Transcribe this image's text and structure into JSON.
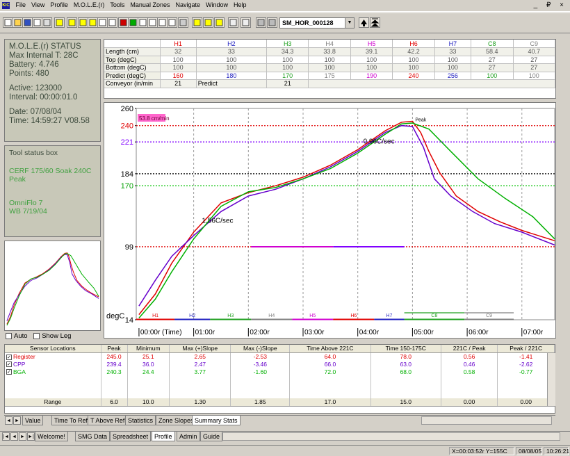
{
  "menu": {
    "items": [
      "File",
      "View",
      "Profile",
      "M.O.L.E.(r)",
      "Tools",
      "Manual Zones",
      "Navigate",
      "Window",
      "Help"
    ],
    "logo": "KIC",
    "window_controls": "_ ₽ ×"
  },
  "toolbar": {
    "icons": [
      "new-icon",
      "open-icon",
      "save-icon",
      "print-preview-icon",
      "print-icon",
      "help-icon",
      "zoom-icon",
      "measure-icon",
      "slope-icon",
      "area-icon",
      "sigma-icon",
      "pen-red-icon",
      "pen-green-icon",
      "curve-icon",
      "lasso-icon",
      "eye-icon",
      "magnify-icon",
      "eraser-icon",
      "face-1-icon",
      "face-2-icon",
      "face-3-icon",
      "calculator-icon",
      "grid-icon",
      "down-arrow-icon",
      "down-arrow-2-icon"
    ],
    "file_selected": "SM_HOR_000128"
  },
  "status": {
    "title": "M.O.L.E.(r) STATUS",
    "internal": "Max Internal T: 28C",
    "battery": "Battery: 4.746",
    "points": "Points: 480",
    "active": "Active: 123000",
    "interval": "Interval: 00:00:01.0",
    "date": "Date: 07/08/04",
    "time": "Time: 14:59:27  V08.58"
  },
  "toolbox": {
    "title": "Tool status box",
    "recipe": "CERF 175/60 Soak 240C Peak",
    "oven": "OmniFlo 7",
    "wb": "WB 7/19/04"
  },
  "legend_toggles": {
    "auto": "Auto",
    "show_leg": "Show Leg"
  },
  "zones": {
    "headers": [
      "H1",
      "H2",
      "H3",
      "H4",
      "H5",
      "H6",
      "H7",
      "C8",
      "C9"
    ],
    "header_colors": [
      "#e00000",
      "#2020c0",
      "#20a020",
      "#808080",
      "#d000d0",
      "#e00000",
      "#2020c0",
      "#20a020",
      "#808080"
    ],
    "rows": [
      {
        "label": "Length (cm)",
        "values": [
          "32",
          "33",
          "34.3",
          "33.8",
          "39.1",
          "42.2",
          "33",
          "58.4",
          "40.7"
        ]
      },
      {
        "label": "Top (degC)",
        "values": [
          "100",
          "100",
          "100",
          "100",
          "100",
          "100",
          "100",
          "27",
          "27"
        ]
      },
      {
        "label": "Bottom (degC)",
        "values": [
          "100",
          "100",
          "100",
          "100",
          "100",
          "100",
          "100",
          "27",
          "27"
        ]
      },
      {
        "label": "Predict (degC)",
        "values": [
          "160",
          "180",
          "170",
          "175",
          "190",
          "240",
          "256",
          "100",
          "100"
        ]
      }
    ],
    "conveyor_label": "Conveyor (in/min",
    "conveyor_value": "21",
    "predict_label": "Predict",
    "predict_value": "21"
  },
  "chart": {
    "speed_badge": "53.8 cm/min",
    "ylabel": "degC",
    "peak_label": "Peak",
    "slope_up": "1.56C/sec",
    "slope_peak": "0.96C/sec",
    "xlabel_first": "00:00r (Time)",
    "zone_labels": [
      "H1",
      "H2",
      "H3",
      "H4",
      "H5",
      "H6",
      "H7",
      "C8",
      "C9"
    ]
  },
  "chart_data": {
    "type": "line",
    "x_unit": "min",
    "x_ticks": [
      {
        "x": 0,
        "label": "00:00r (Time)"
      },
      {
        "x": 1,
        "label": "01:00r"
      },
      {
        "x": 2,
        "label": "02:00r"
      },
      {
        "x": 3,
        "label": "03:00r"
      },
      {
        "x": 4,
        "label": "04:00r"
      },
      {
        "x": 5,
        "label": "05:00r"
      },
      {
        "x": 6,
        "label": "06:00r"
      },
      {
        "x": 7,
        "label": "07:00r"
      }
    ],
    "y_ticks": [
      14,
      99,
      170,
      184,
      221,
      240,
      260
    ],
    "xlim": [
      -0.05,
      7.6
    ],
    "ylim": [
      14,
      260
    ],
    "ref_lines": [
      {
        "y": 240,
        "color": "#e00000",
        "style": "dotted"
      },
      {
        "y": 221,
        "color": "#8000ff",
        "style": "dotted"
      },
      {
        "y": 184,
        "color": "#000000",
        "style": "dotted"
      },
      {
        "y": 170,
        "color": "#00c000",
        "style": "dotted"
      },
      {
        "y": 99,
        "color": "#e00000",
        "style": "dotted"
      }
    ],
    "y_tick_colors": {
      "14": "#000",
      "99": "#000",
      "170": "#00a000",
      "184": "#000",
      "221": "#8000ff",
      "240": "#e00000",
      "260": "#000"
    },
    "series": [
      {
        "name": "Register",
        "color": "#e00000",
        "points": [
          [
            0,
            20
          ],
          [
            0.3,
            44
          ],
          [
            0.6,
            80
          ],
          [
            1,
            116
          ],
          [
            1.5,
            150
          ],
          [
            2,
            162
          ],
          [
            2.5,
            170
          ],
          [
            3,
            180
          ],
          [
            3.5,
            194
          ],
          [
            4,
            212
          ],
          [
            4.5,
            234
          ],
          [
            4.8,
            244
          ],
          [
            5,
            245
          ],
          [
            5.15,
            232
          ],
          [
            5.3,
            210
          ],
          [
            5.5,
            185
          ],
          [
            5.8,
            158
          ],
          [
            6.2,
            140
          ],
          [
            6.6,
            128
          ],
          [
            7,
            118
          ],
          [
            7.6,
            106
          ]
        ]
      },
      {
        "name": "CPP",
        "color": "#6600cc",
        "points": [
          [
            0,
            30
          ],
          [
            0.3,
            60
          ],
          [
            0.6,
            88
          ],
          [
            1,
            112
          ],
          [
            1.5,
            140
          ],
          [
            2,
            158
          ],
          [
            2.5,
            166
          ],
          [
            3,
            178
          ],
          [
            3.5,
            192
          ],
          [
            4,
            210
          ],
          [
            4.5,
            232
          ],
          [
            4.8,
            240
          ],
          [
            5,
            239
          ],
          [
            5.2,
            215
          ],
          [
            5.4,
            178
          ],
          [
            5.7,
            158
          ],
          [
            6.1,
            140
          ],
          [
            6.5,
            126
          ],
          [
            7,
            116
          ],
          [
            7.6,
            101
          ]
        ]
      },
      {
        "name": "BGA",
        "color": "#00b000",
        "points": [
          [
            0,
            16
          ],
          [
            0.3,
            38
          ],
          [
            0.6,
            70
          ],
          [
            1,
            108
          ],
          [
            1.5,
            146
          ],
          [
            2,
            163
          ],
          [
            2.5,
            168
          ],
          [
            3,
            178
          ],
          [
            3.5,
            190
          ],
          [
            4,
            208
          ],
          [
            4.5,
            230
          ],
          [
            4.8,
            242
          ],
          [
            5,
            243
          ],
          [
            5.3,
            236
          ],
          [
            5.7,
            210
          ],
          [
            6.2,
            178
          ],
          [
            6.7,
            155
          ],
          [
            7.2,
            134
          ],
          [
            7.6,
            108
          ]
        ]
      }
    ],
    "zone_bars": [
      {
        "x1": -0.05,
        "x2": 0.65,
        "color": "#e00000"
      },
      {
        "x1": 0.65,
        "x2": 1.3,
        "color": "#2020c0"
      },
      {
        "x1": 1.3,
        "x2": 2.05,
        "color": "#20a020"
      },
      {
        "x1": 2.05,
        "x2": 2.8,
        "color": "#808080"
      },
      {
        "x1": 2.8,
        "x2": 3.55,
        "color": "#d000d0"
      },
      {
        "x1": 3.55,
        "x2": 4.3,
        "color": "#e00000"
      },
      {
        "x1": 4.3,
        "x2": 4.85,
        "color": "#2020c0"
      },
      {
        "x1": 4.85,
        "x2": 5.95,
        "color": "#20a020"
      },
      {
        "x1": 5.95,
        "x2": 6.85,
        "color": "#808080"
      }
    ],
    "soak_segments": [
      {
        "x1": 2.05,
        "x2": 3.55,
        "y": 99,
        "color": "#d000d0"
      },
      {
        "x1": 3.55,
        "x2": 4.85,
        "y": 99,
        "color": "#8000ff"
      }
    ]
  },
  "stats": {
    "headers": [
      "Sensor Locations",
      "Peak",
      "Minimum",
      "Max (+)Slope",
      "Max (-)Slope",
      "Time Above 221C",
      "Time 150-175C",
      "221C / Peak",
      "Peak / 221C"
    ],
    "rows": [
      {
        "name": "Register",
        "color": "#e00000",
        "values": [
          "245.0",
          "25.1",
          "2.65",
          "-2.53",
          "64.0",
          "78.0",
          "0.56",
          "-1.41"
        ]
      },
      {
        "name": "CPP",
        "color": "#6600cc",
        "values": [
          "239.4",
          "36.0",
          "2.47",
          "-3.46",
          "66.0",
          "63.0",
          "0.46",
          "-2.62"
        ]
      },
      {
        "name": "BGA",
        "color": "#00b000",
        "values": [
          "240.3",
          "24.4",
          "3.77",
          "-1.60",
          "72.0",
          "68.0",
          "0.58",
          "-0.77"
        ]
      }
    ],
    "range_label": "Range",
    "range_values": [
      "6.0",
      "10.0",
      "1.30",
      "1.85",
      "17.0",
      "15.0",
      "0.00",
      "0.00"
    ]
  },
  "tabs_inner": [
    "Value",
    "Time To Ref",
    "T Above Ref",
    "Statistics",
    "Zone Slopes",
    "Summary Stats"
  ],
  "tabs_inner_active": "Summary Stats",
  "tabs_outer": [
    "Welcome!",
    "SMG Data",
    "Spreadsheet",
    "Profile",
    "Admin",
    "Guide"
  ],
  "tabs_outer_active": "Profile",
  "statusbar": {
    "coords": "X=00:03:52r Y=155C",
    "date": "08/08/05",
    "time": "10:26:21"
  }
}
